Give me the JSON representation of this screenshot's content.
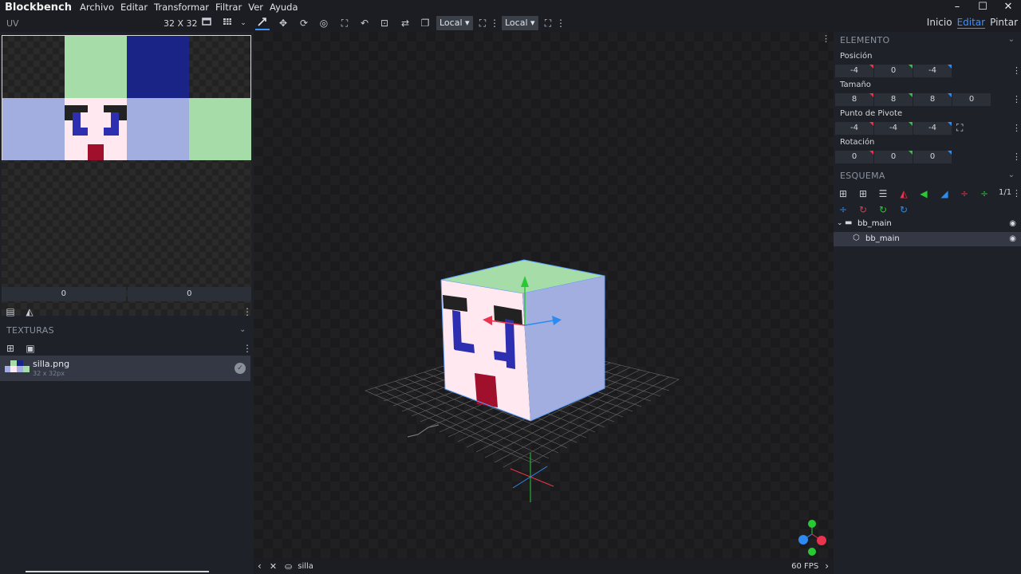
{
  "app": {
    "title": "Blockbench"
  },
  "menu": [
    "Archivo",
    "Editar",
    "Transformar",
    "Filtrar",
    "Ver",
    "Ayuda"
  ],
  "window_controls": [
    "–",
    "☐",
    "✕"
  ],
  "toolbar": {
    "uv_title": "UV",
    "uv_size": "32 X 32",
    "local_1": "Local",
    "local_2": "Local",
    "modes": [
      "Inicio",
      "Editar",
      "Pintar"
    ],
    "active_mode": "Editar"
  },
  "uv": {
    "field_1": "0",
    "field_2": "0"
  },
  "textures": {
    "section": "TEXTURAS",
    "items": [
      {
        "name": "silla.png",
        "size": "32 x 32px"
      }
    ]
  },
  "element": {
    "section": "ELEMENTO",
    "posicion": {
      "label": "Posición",
      "values": [
        "-4",
        "0",
        "-4"
      ]
    },
    "tamano": {
      "label": "Tamaño",
      "values": [
        "8",
        "8",
        "8",
        "0"
      ]
    },
    "pivote": {
      "label": "Punto de Pivote",
      "values": [
        "-4",
        "-4",
        "-4"
      ]
    },
    "rotacion": {
      "label": "Rotación",
      "values": [
        "0",
        "0",
        "0"
      ]
    }
  },
  "outline": {
    "section": "ESQUEMA",
    "page_count": "1/1",
    "items": [
      {
        "label": "bb_main",
        "type": "group"
      },
      {
        "label": "bb_main",
        "type": "cube"
      }
    ]
  },
  "status": {
    "model": "silla",
    "fps": "60 FPS"
  },
  "colors": {
    "accent": "#3e90ff",
    "x_axis": "#e8344e",
    "y_axis": "#29c934",
    "z_axis": "#2d8bf0"
  }
}
